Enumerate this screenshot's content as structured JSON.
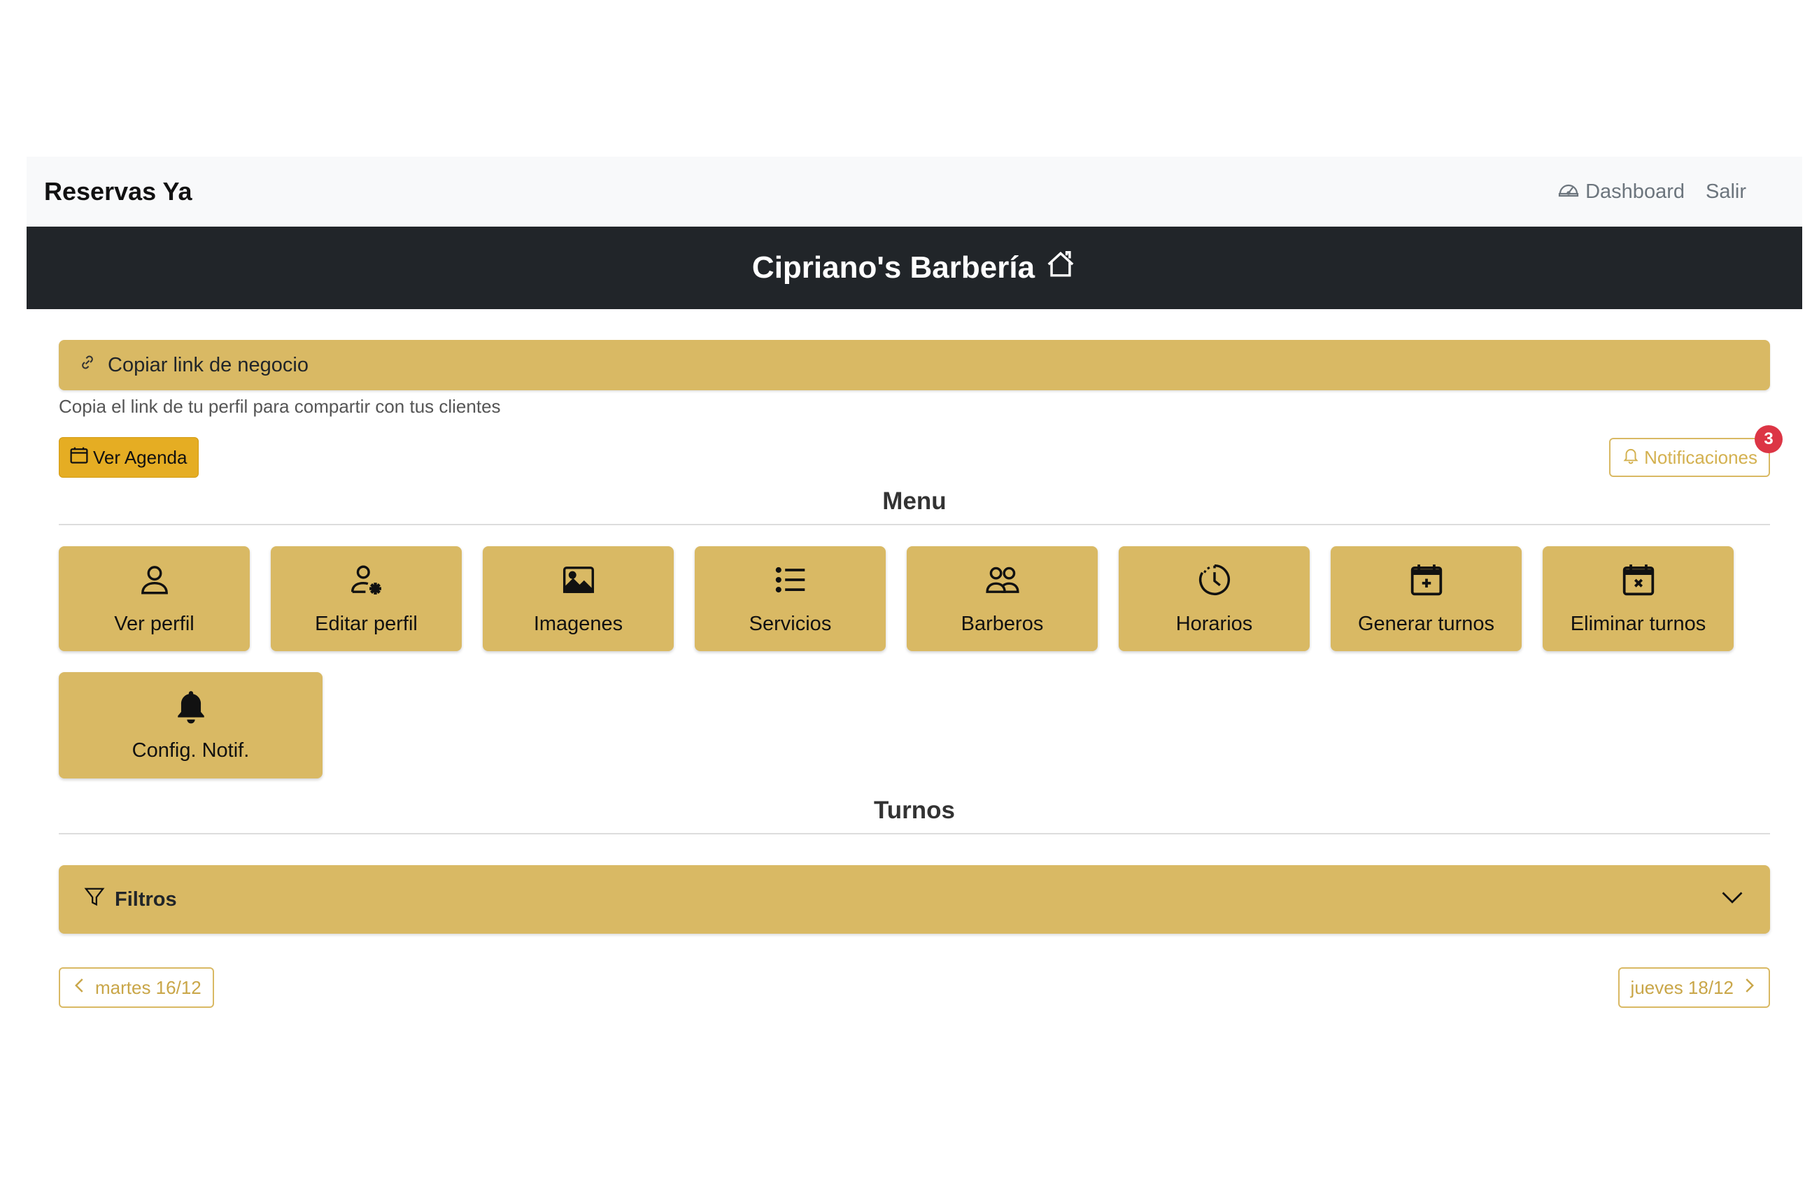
{
  "navbar": {
    "brand": "Reservas Ya",
    "dashboard_label": "Dashboard",
    "logout_label": "Salir"
  },
  "banner": {
    "title": "Cipriano's Barbería"
  },
  "copy_link": {
    "label": "Copiar link de negocio",
    "helper": "Copia el link de tu perfil para compartir con tus clientes"
  },
  "actions": {
    "agenda_label": "Ver Agenda",
    "notifications_label": "Notificaciones",
    "notifications_count": "3"
  },
  "menu": {
    "title": "Menu",
    "tiles": [
      {
        "label": "Ver perfil",
        "icon": "person-icon"
      },
      {
        "label": "Editar perfil",
        "icon": "person-gear-icon"
      },
      {
        "label": "Imagenes",
        "icon": "image-icon"
      },
      {
        "label": "Servicios",
        "icon": "list-icon"
      },
      {
        "label": "Barberos",
        "icon": "people-icon"
      },
      {
        "label": "Horarios",
        "icon": "clock-icon"
      },
      {
        "label": "Generar turnos",
        "icon": "calendar-plus-icon"
      },
      {
        "label": "Eliminar turnos",
        "icon": "calendar-x-icon"
      },
      {
        "label": "Config. Notif.",
        "icon": "bell-fill-icon"
      }
    ]
  },
  "turnos": {
    "title": "Turnos",
    "filters_label": "Filtros",
    "prev_day": "martes 16/12",
    "next_day": "jueves 18/12"
  }
}
